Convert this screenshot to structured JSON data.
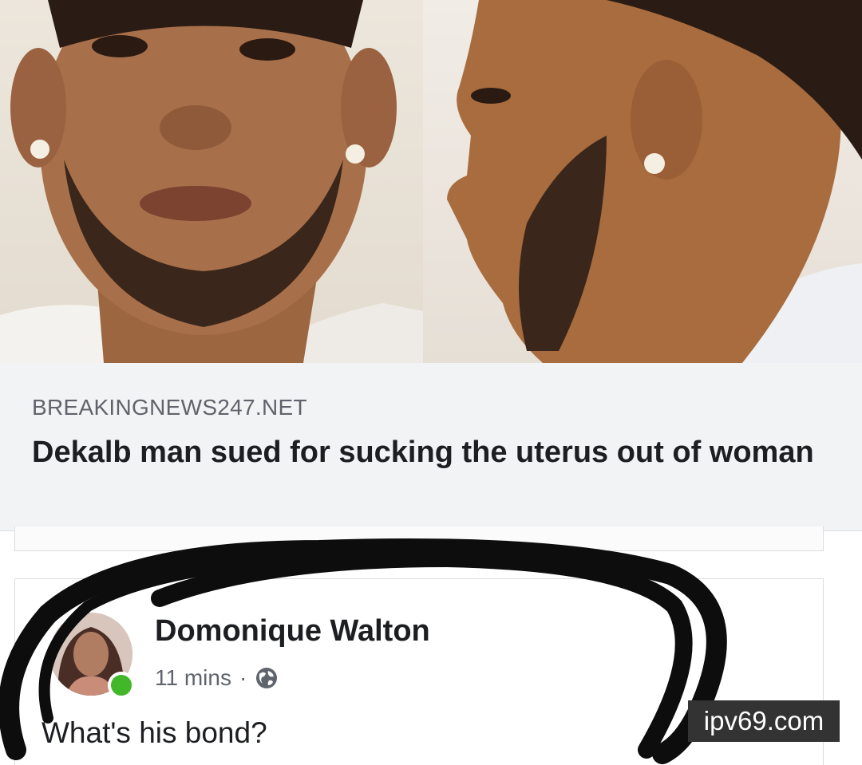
{
  "link_preview": {
    "image": {
      "left_photo": "front-view-mugshot",
      "right_photo": "side-profile-mugshot"
    },
    "source": "BREAKINGNEWS247.NET",
    "headline": "Dekalb man sued for sucking the uterus out of woman"
  },
  "comment": {
    "author": "Domonique Walton",
    "timestamp": "11 mins",
    "separator": "·",
    "privacy_icon": "globe-icon",
    "text": "What's his bond?",
    "online_indicator_color": "#42b72a"
  },
  "overlay": {
    "annotation": "black-marker-circle"
  },
  "watermark": {
    "text": "ipv69.com"
  },
  "colors": {
    "preview_background": "#f2f3f5",
    "headline_text": "#1c1e21",
    "source_text": "#5f646c",
    "watermark_background": "#333333"
  }
}
